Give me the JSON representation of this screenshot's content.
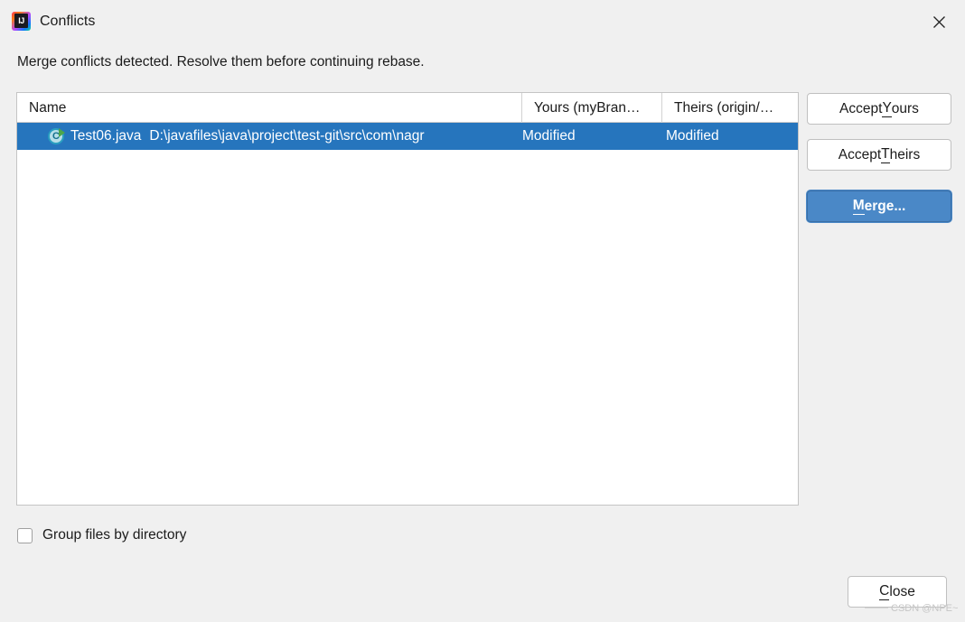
{
  "window": {
    "title": "Conflicts",
    "app_icon": "intellij-idea-icon",
    "icon_text": "IJ",
    "close_icon": "close-icon"
  },
  "message": "Merge conflicts detected. Resolve them before continuing rebase.",
  "table": {
    "columns": [
      {
        "key": "name",
        "label": "Name"
      },
      {
        "key": "yours",
        "label": "Yours (myBran…"
      },
      {
        "key": "theirs",
        "label": "Theirs (origin/…"
      }
    ],
    "rows": [
      {
        "icon": "java-class-runnable-icon",
        "icon_letter": "C",
        "name": "Test06.java",
        "path": "D:\\javafiles\\java\\project\\test-git\\src\\com\\nagr",
        "yours": "Modified",
        "theirs": "Modified",
        "selected": true
      }
    ]
  },
  "actions": {
    "accept_yours": {
      "prefix": "Accept ",
      "mnemonic": "Y",
      "suffix": "ours"
    },
    "accept_theirs": {
      "prefix": "Accept ",
      "mnemonic": "T",
      "suffix": "heirs"
    },
    "merge": {
      "prefix": "",
      "mnemonic": "M",
      "suffix": "erge..."
    }
  },
  "options": {
    "group_files_by_directory": {
      "label": "Group files by directory",
      "checked": false
    }
  },
  "footer": {
    "close": {
      "prefix": "",
      "mnemonic": "C",
      "suffix": "lose"
    }
  },
  "watermark": "CSDN @NPE~",
  "colors": {
    "dialog_background": "#f0f0f0",
    "selection_blue": "#2675bd",
    "primary_button": "#4a88c7",
    "table_background": "#ffffff",
    "text": "#1b1b1b",
    "watermark": "#c6c6c6"
  }
}
